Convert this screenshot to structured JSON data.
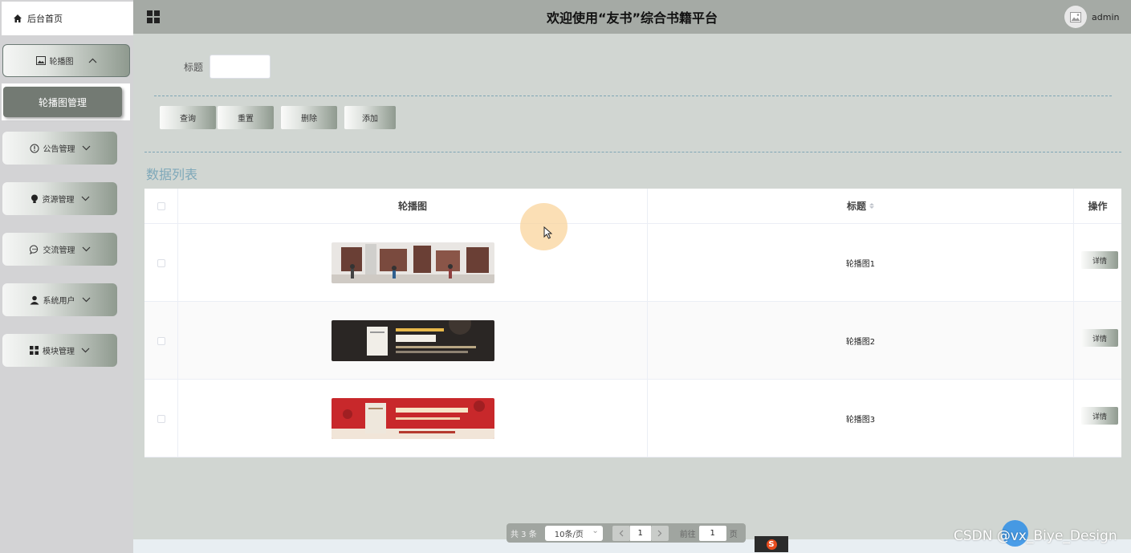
{
  "sidebar": {
    "home": "后台首页",
    "menus": [
      {
        "label": "轮播图",
        "icon": "image-icon",
        "open": true
      },
      {
        "label": "公告管理",
        "icon": "info-icon"
      },
      {
        "label": "资源管理",
        "icon": "bulb-icon"
      },
      {
        "label": "交流管理",
        "icon": "chat-icon"
      },
      {
        "label": "系统用户",
        "icon": "user-icon"
      },
      {
        "label": "模块管理",
        "icon": "grid-icon"
      }
    ],
    "submenu_active": "轮播图管理"
  },
  "header": {
    "title": "欢迎使用“友书”综合书籍平台",
    "user": "admin"
  },
  "search": {
    "label": "标题",
    "value": ""
  },
  "actions": {
    "query": "查询",
    "reset": "重置",
    "delete": "删除",
    "add": "添加"
  },
  "list_title": "数据列表",
  "table": {
    "columns": [
      "轮播图",
      "标题",
      "操作"
    ],
    "rows": [
      {
        "title": "轮播图1",
        "action": "详情",
        "image": "bookstore-scene"
      },
      {
        "title": "轮播图2",
        "action": "详情",
        "image": "book-promo-dark"
      },
      {
        "title": "轮播图3",
        "action": "详情",
        "image": "book-promo-red"
      }
    ]
  },
  "pager": {
    "total": "共 3 条",
    "page_size": "10条/页",
    "current": "1",
    "goto_label": "前往",
    "goto_value": "1",
    "page_unit": "页"
  },
  "watermark": "CSDN @vx_Biye_Design",
  "colors": {
    "header_bg": "#a5aaa5",
    "content_bg": "#d1d6d2",
    "sidebar_bg": "#d3d3d5",
    "accent_text": "#7ea8b9"
  }
}
